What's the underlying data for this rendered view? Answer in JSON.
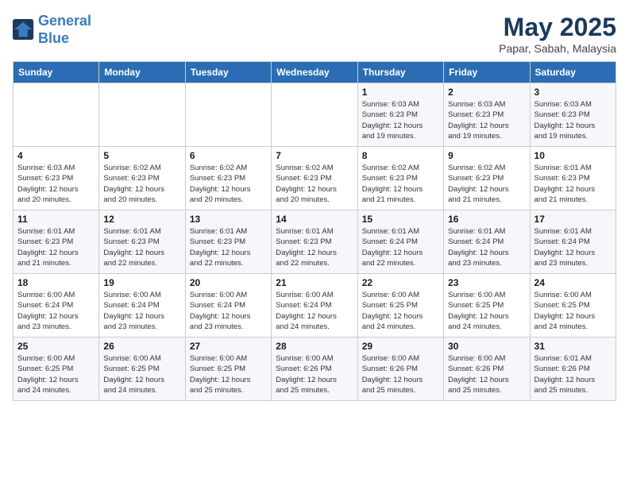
{
  "header": {
    "logo_line1": "General",
    "logo_line2": "Blue",
    "month": "May 2025",
    "location": "Papar, Sabah, Malaysia"
  },
  "days_of_week": [
    "Sunday",
    "Monday",
    "Tuesday",
    "Wednesday",
    "Thursday",
    "Friday",
    "Saturday"
  ],
  "weeks": [
    [
      {
        "day": "",
        "info": ""
      },
      {
        "day": "",
        "info": ""
      },
      {
        "day": "",
        "info": ""
      },
      {
        "day": "",
        "info": ""
      },
      {
        "day": "1",
        "info": "Sunrise: 6:03 AM\nSunset: 6:23 PM\nDaylight: 12 hours\nand 19 minutes."
      },
      {
        "day": "2",
        "info": "Sunrise: 6:03 AM\nSunset: 6:23 PM\nDaylight: 12 hours\nand 19 minutes."
      },
      {
        "day": "3",
        "info": "Sunrise: 6:03 AM\nSunset: 6:23 PM\nDaylight: 12 hours\nand 19 minutes."
      }
    ],
    [
      {
        "day": "4",
        "info": "Sunrise: 6:03 AM\nSunset: 6:23 PM\nDaylight: 12 hours\nand 20 minutes."
      },
      {
        "day": "5",
        "info": "Sunrise: 6:02 AM\nSunset: 6:23 PM\nDaylight: 12 hours\nand 20 minutes."
      },
      {
        "day": "6",
        "info": "Sunrise: 6:02 AM\nSunset: 6:23 PM\nDaylight: 12 hours\nand 20 minutes."
      },
      {
        "day": "7",
        "info": "Sunrise: 6:02 AM\nSunset: 6:23 PM\nDaylight: 12 hours\nand 20 minutes."
      },
      {
        "day": "8",
        "info": "Sunrise: 6:02 AM\nSunset: 6:23 PM\nDaylight: 12 hours\nand 21 minutes."
      },
      {
        "day": "9",
        "info": "Sunrise: 6:02 AM\nSunset: 6:23 PM\nDaylight: 12 hours\nand 21 minutes."
      },
      {
        "day": "10",
        "info": "Sunrise: 6:01 AM\nSunset: 6:23 PM\nDaylight: 12 hours\nand 21 minutes."
      }
    ],
    [
      {
        "day": "11",
        "info": "Sunrise: 6:01 AM\nSunset: 6:23 PM\nDaylight: 12 hours\nand 21 minutes."
      },
      {
        "day": "12",
        "info": "Sunrise: 6:01 AM\nSunset: 6:23 PM\nDaylight: 12 hours\nand 22 minutes."
      },
      {
        "day": "13",
        "info": "Sunrise: 6:01 AM\nSunset: 6:23 PM\nDaylight: 12 hours\nand 22 minutes."
      },
      {
        "day": "14",
        "info": "Sunrise: 6:01 AM\nSunset: 6:23 PM\nDaylight: 12 hours\nand 22 minutes."
      },
      {
        "day": "15",
        "info": "Sunrise: 6:01 AM\nSunset: 6:24 PM\nDaylight: 12 hours\nand 22 minutes."
      },
      {
        "day": "16",
        "info": "Sunrise: 6:01 AM\nSunset: 6:24 PM\nDaylight: 12 hours\nand 23 minutes."
      },
      {
        "day": "17",
        "info": "Sunrise: 6:01 AM\nSunset: 6:24 PM\nDaylight: 12 hours\nand 23 minutes."
      }
    ],
    [
      {
        "day": "18",
        "info": "Sunrise: 6:00 AM\nSunset: 6:24 PM\nDaylight: 12 hours\nand 23 minutes."
      },
      {
        "day": "19",
        "info": "Sunrise: 6:00 AM\nSunset: 6:24 PM\nDaylight: 12 hours\nand 23 minutes."
      },
      {
        "day": "20",
        "info": "Sunrise: 6:00 AM\nSunset: 6:24 PM\nDaylight: 12 hours\nand 23 minutes."
      },
      {
        "day": "21",
        "info": "Sunrise: 6:00 AM\nSunset: 6:24 PM\nDaylight: 12 hours\nand 24 minutes."
      },
      {
        "day": "22",
        "info": "Sunrise: 6:00 AM\nSunset: 6:25 PM\nDaylight: 12 hours\nand 24 minutes."
      },
      {
        "day": "23",
        "info": "Sunrise: 6:00 AM\nSunset: 6:25 PM\nDaylight: 12 hours\nand 24 minutes."
      },
      {
        "day": "24",
        "info": "Sunrise: 6:00 AM\nSunset: 6:25 PM\nDaylight: 12 hours\nand 24 minutes."
      }
    ],
    [
      {
        "day": "25",
        "info": "Sunrise: 6:00 AM\nSunset: 6:25 PM\nDaylight: 12 hours\nand 24 minutes."
      },
      {
        "day": "26",
        "info": "Sunrise: 6:00 AM\nSunset: 6:25 PM\nDaylight: 12 hours\nand 24 minutes."
      },
      {
        "day": "27",
        "info": "Sunrise: 6:00 AM\nSunset: 6:25 PM\nDaylight: 12 hours\nand 25 minutes."
      },
      {
        "day": "28",
        "info": "Sunrise: 6:00 AM\nSunset: 6:26 PM\nDaylight: 12 hours\nand 25 minutes."
      },
      {
        "day": "29",
        "info": "Sunrise: 6:00 AM\nSunset: 6:26 PM\nDaylight: 12 hours\nand 25 minutes."
      },
      {
        "day": "30",
        "info": "Sunrise: 6:00 AM\nSunset: 6:26 PM\nDaylight: 12 hours\nand 25 minutes."
      },
      {
        "day": "31",
        "info": "Sunrise: 6:01 AM\nSunset: 6:26 PM\nDaylight: 12 hours\nand 25 minutes."
      }
    ]
  ]
}
